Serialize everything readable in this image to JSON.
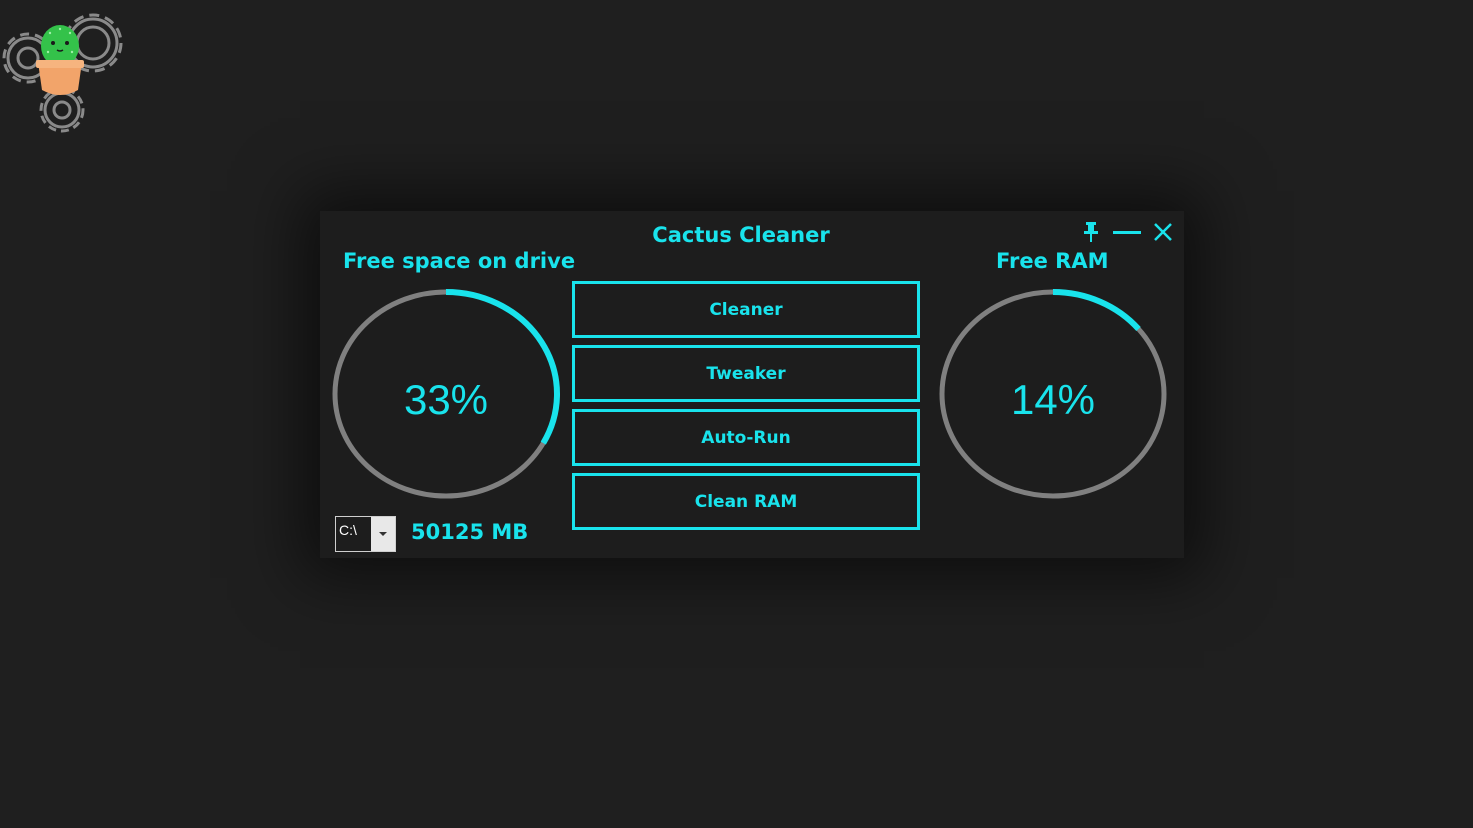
{
  "window": {
    "title": "Cactus Cleaner",
    "controls": {
      "pin_icon": "pin-icon",
      "minimize_icon": "minimize-icon",
      "close_icon": "close-icon"
    }
  },
  "drive": {
    "label": "Free space on drive",
    "percent_text": "33%",
    "percent_value": 0.33,
    "selected_drive": "C:\\",
    "free_text": "50125 MB"
  },
  "ram": {
    "label": "Free RAM",
    "percent_text": "14%",
    "percent_value": 0.14
  },
  "buttons": {
    "cleaner": "Cleaner",
    "tweaker": "Tweaker",
    "autorun": "Auto-Run",
    "clean_ram": "Clean RAM"
  },
  "colors": {
    "accent": "#19e3ec",
    "track": "#808080",
    "background": "#1d1d1d",
    "desktop": "#1f1f1f"
  }
}
